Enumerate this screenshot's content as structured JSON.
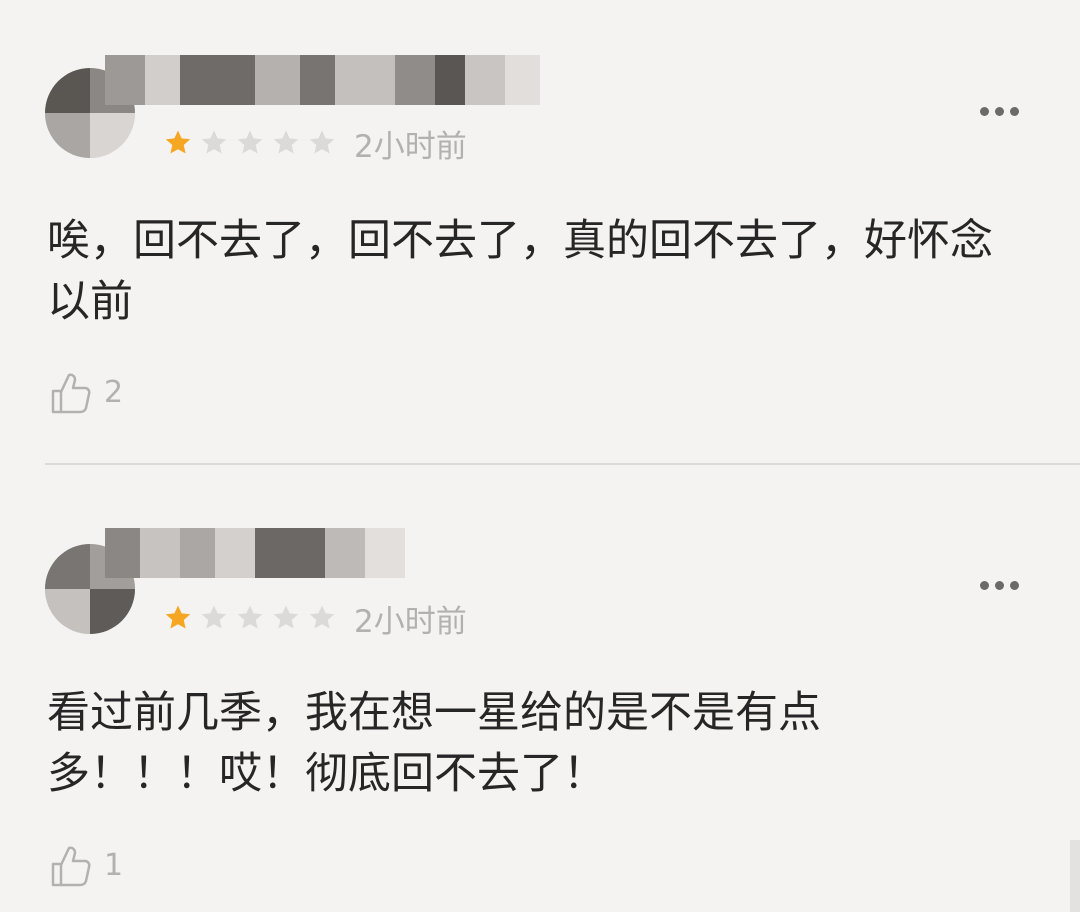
{
  "reviews": [
    {
      "username": "",
      "rating": 1,
      "max_rating": 5,
      "time": "2小时前",
      "content": "唉，回不去了，回不去了，真的回不去了，好怀念以前",
      "likes": "2",
      "icons": {
        "avatar": "blurred-avatar",
        "more": "more-dots-icon",
        "like": "thumbs-up-icon",
        "star": "star-icon"
      }
    },
    {
      "username": "",
      "rating": 1,
      "max_rating": 5,
      "time": "2小时前",
      "content": "看过前几季，我在想一星给的是不是有点多！！！哎！彻底回不去了！",
      "likes": "1",
      "icons": {
        "avatar": "blurred-avatar",
        "more": "more-dots-icon",
        "like": "thumbs-up-icon",
        "star": "star-icon"
      }
    }
  ],
  "colors": {
    "background": "#f5f3f2",
    "star_filled": "#f5a623",
    "star_empty": "#dcdad9",
    "meta_text": "#b3b1b0",
    "content_text": "#262626",
    "divider": "#dcdad9"
  }
}
